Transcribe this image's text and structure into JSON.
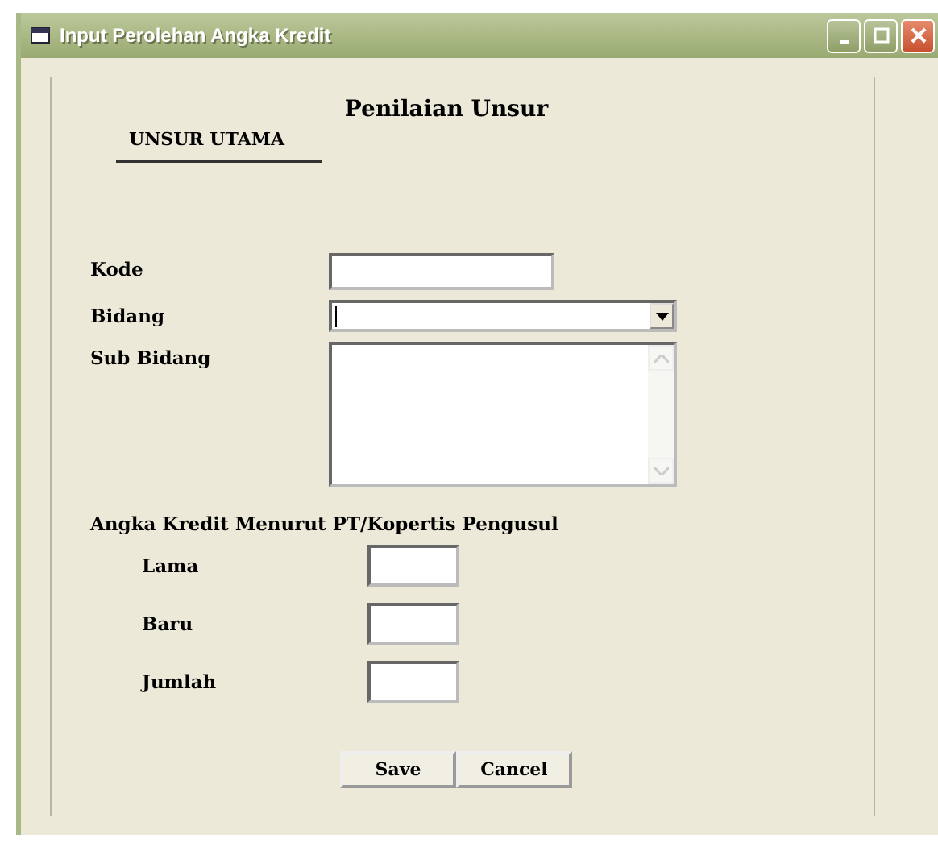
{
  "window": {
    "title": "Input Perolehan Angka Kredit"
  },
  "heading": "Penilaian Unsur",
  "section_tab": "UNSUR UTAMA",
  "fields": [
    {
      "kind": "text",
      "label": "Kode"
    },
    {
      "kind": "dropdown",
      "label": "Bidang"
    },
    {
      "kind": "textarea",
      "label": "Sub Bidang"
    }
  ],
  "credit_group": {
    "title": "Angka Kredit Menurut PT/Kopertis Pengusul",
    "fields": [
      {
        "label": "Lama"
      },
      {
        "label": "Baru"
      },
      {
        "label": "Jumlah"
      }
    ]
  },
  "buttons": [
    "Save",
    "Cancel"
  ]
}
